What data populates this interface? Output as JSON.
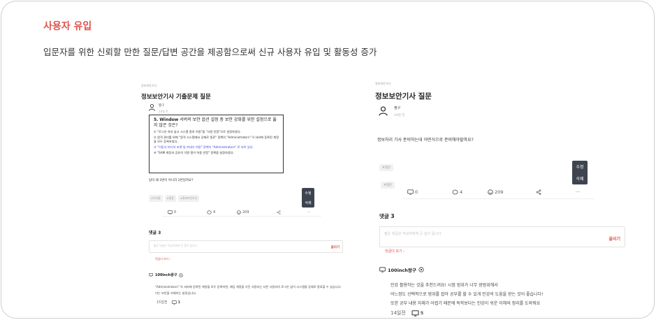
{
  "header": {
    "title": "사용자 유입",
    "description": "입문자를 위한 신뢰할 만한 질문/답변 공간을 제공함으로써 신규 사용자 유입 및 활동성 증가"
  },
  "left": {
    "breadcrumb": "정보보안기사",
    "title": "정보보안기사 기출문제 질문",
    "author": {
      "name": "짱구",
      "date": "14일 전"
    },
    "question": {
      "number": "5.",
      "keyword": "Window",
      "text": "서버의 보안 옵션 설정 중 보안 강화를 위한 설정으로 옳지 않은 것은?",
      "options": [
        "① \"로그온 하지 않고 시스템 종료 허용\"을 \"사용 안함\"으로 설정하였다.",
        "② 원격 관리를 위해 \"원격 시스템에서 강제로 종료\" 정책의 \"Administrators\" 이 서버에 등록된 계정을 모두 등록하였다.",
        "③ \"이동식 미디어 포맷 및 꺼내기 허용\" 정책이 \"Administrators\" 로 되어 있다.",
        "④ \"SAM 계정과 공유의 익명 열거 허용 안함\" 정책을 설정하였다."
      ]
    },
    "answer_line": "답이 왜 3번이 아니라 2번일까요?",
    "tags": [
      "#기사질",
      "#질문",
      "#정보보안기사"
    ],
    "popup": {
      "edit": "수정",
      "delete": "삭제"
    },
    "actions": {
      "views": "0",
      "likes": "4",
      "emoji": "209",
      "more": "···"
    },
    "comments": {
      "heading": "댓글 3",
      "placeholder": "짧은 댓글은 작성자에게 큰 힘이 됩니다",
      "post": "올리기",
      "more": "댓글더 보기 ›",
      "first_user": "100inch왕구",
      "first_text": "\"Administrators\" 의 서버에 등록된 계정을 모두 등록하면, 해당 계정을 가진 사용자는 다른 사용자의 로그온 없이 시스템을 강제로 종료할 수 있습니다. 이는 보안을 저해하는 설정입니다.",
      "first_time": "15일전",
      "first_count": "1"
    }
  },
  "right": {
    "breadcrumb": "정보보안기사",
    "title": "정보보안기사 질문",
    "author": {
      "name": "짱구",
      "date": "14일 전"
    },
    "question": "정보처리 기사 준비하는데 어떤식으로 준비해야할까요?",
    "tags": [
      "#질문",
      "#질문"
    ],
    "popup": {
      "edit": "수정",
      "delete": "삭제"
    },
    "actions": {
      "views": "0",
      "likes": "4",
      "emoji": "209",
      "more": "···"
    },
    "comments": {
      "heading": "댓글 3",
      "placeholder": "짧은 댓글은 작성자에게 큰 힘이 됩니다",
      "post": "올리기",
      "more": "댓글더 보기 ›",
      "first_user": "100inch왕구",
      "lines": [
        "인강 활용하는 것을 추천드려요! 시험 범위가 너무 광범위해서",
        "어느정도 선택적으로 범위를 잡아 공부를 할 수 있게 인강의 도움을 받는 것이 좋습니다!",
        "또한 공부 내용 자체가 어렵기 때문에 독학보다는 인강이 쉬운 이해와 정리를 도와줘요"
      ],
      "first_time": "14일전",
      "first_count": "5"
    }
  },
  "colors": {
    "accent": "#e0544d",
    "popup_bg": "#3d4450",
    "blue_option": "#2f4bd6"
  }
}
